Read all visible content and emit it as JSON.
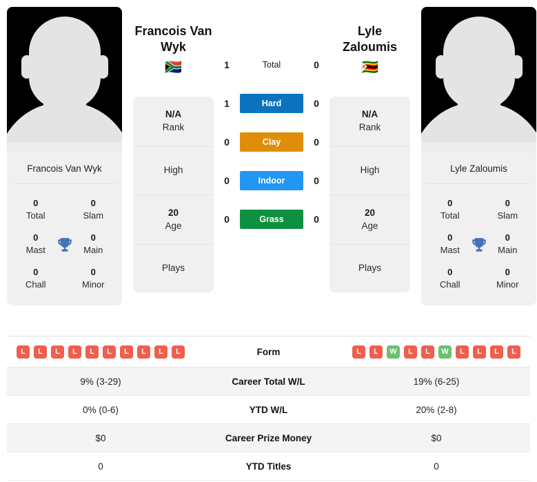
{
  "players": {
    "left": {
      "name_display": "Francois Van\nWyk",
      "name_line1": "Francois Van",
      "name_line2": "Wyk",
      "flag": "🇿🇦",
      "flag_name": "south-africa-flag",
      "card_name": "Francois Van Wyk",
      "rank": "N/A",
      "rank_label": "Rank",
      "high_value": "",
      "high_label": "High",
      "age": "20",
      "age_label": "Age",
      "plays_value": "",
      "plays_label": "Plays",
      "titles": [
        {
          "num": "0",
          "label": "Total"
        },
        {
          "num": "0",
          "label": "Slam"
        },
        {
          "num": "0",
          "label": "Mast"
        },
        {
          "num": "0",
          "label": "Main"
        },
        {
          "num": "0",
          "label": "Chall"
        },
        {
          "num": "0",
          "label": "Minor"
        }
      ],
      "form": [
        "L",
        "L",
        "L",
        "L",
        "L",
        "L",
        "L",
        "L",
        "L",
        "L"
      ]
    },
    "right": {
      "name_display": "Lyle\nZaloumis",
      "name_line1": "Lyle",
      "name_line2": "Zaloumis",
      "flag": "🇿🇼",
      "flag_name": "zimbabwe-flag",
      "card_name": "Lyle Zaloumis",
      "rank": "N/A",
      "rank_label": "Rank",
      "high_value": "",
      "high_label": "High",
      "age": "20",
      "age_label": "Age",
      "plays_value": "",
      "plays_label": "Plays",
      "titles": [
        {
          "num": "0",
          "label": "Total"
        },
        {
          "num": "0",
          "label": "Slam"
        },
        {
          "num": "0",
          "label": "Mast"
        },
        {
          "num": "0",
          "label": "Main"
        },
        {
          "num": "0",
          "label": "Chall"
        },
        {
          "num": "0",
          "label": "Minor"
        }
      ],
      "form": [
        "L",
        "L",
        "W",
        "L",
        "L",
        "W",
        "L",
        "L",
        "L",
        "L"
      ]
    }
  },
  "h2h": {
    "rows": [
      {
        "label": "Total",
        "left": "1",
        "right": "0",
        "color": "transparent",
        "plain": true
      },
      {
        "label": "Hard",
        "left": "1",
        "right": "0",
        "color": "#0b73bd",
        "plain": false
      },
      {
        "label": "Clay",
        "left": "0",
        "right": "0",
        "color": "#df8e0c",
        "plain": false
      },
      {
        "label": "Indoor",
        "left": "0",
        "right": "0",
        "color": "#2196f3",
        "plain": false
      },
      {
        "label": "Grass",
        "left": "0",
        "right": "0",
        "color": "#0d9140",
        "plain": false
      }
    ]
  },
  "stats": {
    "form_label": "Form",
    "rows": [
      {
        "label": "Career Total W/L",
        "left": "9% (3-29)",
        "right": "19% (6-25)",
        "shaded": true
      },
      {
        "label": "YTD W/L",
        "left": "0% (0-6)",
        "right": "20% (2-8)",
        "shaded": false
      },
      {
        "label": "Career Prize Money",
        "left": "$0",
        "right": "$0",
        "shaded": true
      },
      {
        "label": "YTD Titles",
        "left": "0",
        "right": "0",
        "shaded": false
      }
    ]
  },
  "colors": {
    "hard": "#0b73bd",
    "clay": "#df8e0c",
    "indoor": "#2196f3",
    "grass": "#0d9140",
    "win_badge": "#6cc071",
    "loss_badge": "#ef5e4e",
    "card_bg": "#f0f0f0",
    "row_shade": "#f4f4f4"
  }
}
